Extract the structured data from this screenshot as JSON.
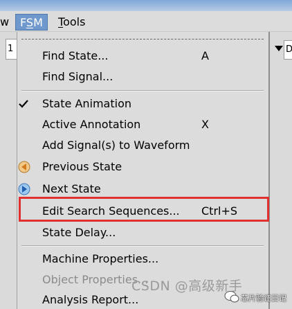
{
  "menubar": {
    "items": [
      {
        "label": "w"
      },
      {
        "label": "FSM",
        "mnemonic": "S"
      },
      {
        "label": "Tools",
        "mnemonic": "T"
      }
    ]
  },
  "toolbar": {
    "left_field_value": "1",
    "right_field_value": "D"
  },
  "fsm_menu": {
    "items": [
      {
        "label": "Find State...",
        "accel": "A",
        "mnemonic": "F"
      },
      {
        "label": "Find Signal...",
        "accel": "",
        "mnemonic": "S"
      },
      {
        "label": "State Animation",
        "accel": "",
        "checked": true
      },
      {
        "label": "Active Annotation",
        "accel": "X"
      },
      {
        "label": "Add Signal(s) to Waveform",
        "accel": ""
      },
      {
        "label": "Previous State",
        "accel": ""
      },
      {
        "label": "Next State",
        "accel": ""
      },
      {
        "label": "Edit Search Sequences...",
        "accel": "Ctrl+S"
      },
      {
        "label": "State Delay...",
        "accel": ""
      },
      {
        "label": "Machine Properties...",
        "accel": ""
      },
      {
        "label": "Object Properties...",
        "accel": "",
        "disabled": true
      },
      {
        "label": "Analysis Report...",
        "accel": ""
      }
    ]
  },
  "colors": {
    "menu_bg": "#dcdcdc",
    "selected_menu": "#6f98cc",
    "highlight_outline": "#e03030",
    "disabled_text": "#8a8a8a"
  },
  "watermark": {
    "text": "CSDN @高级新手",
    "logo_text": "芯片验证日记"
  }
}
